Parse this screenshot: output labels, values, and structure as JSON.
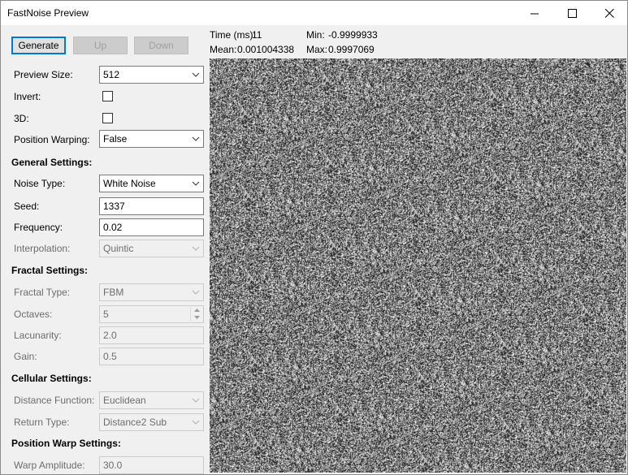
{
  "window": {
    "title": "FastNoise Preview",
    "minimize": "—",
    "maximize": "□",
    "close": "✕"
  },
  "buttons": {
    "generate": "Generate",
    "up": "Up",
    "down": "Down"
  },
  "stats": {
    "time_label": "Time (ms):",
    "time_value": "11",
    "min_label": "Min:",
    "min_value": "-0.9999933",
    "mean_label": "Mean:",
    "mean_value": "0.001004338",
    "max_label": "Max:",
    "max_value": "0.9997069"
  },
  "preview_settings": {
    "size_label": "Preview Size:",
    "size_value": "512",
    "invert_label": "Invert:",
    "invert_checked": false,
    "d3_label": "3D:",
    "d3_checked": false,
    "warp_label": "Position Warping:",
    "warp_value": "False"
  },
  "general": {
    "heading": "General Settings:",
    "noise_type_label": "Noise Type:",
    "noise_type_value": "White Noise",
    "seed_label": "Seed:",
    "seed_value": "1337",
    "frequency_label": "Frequency:",
    "frequency_value": "0.02",
    "interp_label": "Interpolation:",
    "interp_value": "Quintic"
  },
  "fractal": {
    "heading": "Fractal Settings:",
    "type_label": "Fractal Type:",
    "type_value": "FBM",
    "octaves_label": "Octaves:",
    "octaves_value": "5",
    "lacunarity_label": "Lacunarity:",
    "lacunarity_value": "2.0",
    "gain_label": "Gain:",
    "gain_value": "0.5"
  },
  "cellular": {
    "heading": "Cellular Settings:",
    "distance_label": "Distance Function:",
    "distance_value": "Euclidean",
    "return_label": "Return Type:",
    "return_value": "Distance2 Sub"
  },
  "warp": {
    "heading": "Position Warp Settings:",
    "amplitude_label": "Warp Amplitude:",
    "amplitude_value": "30.0"
  },
  "preview": {
    "noise_type": "white-noise"
  }
}
